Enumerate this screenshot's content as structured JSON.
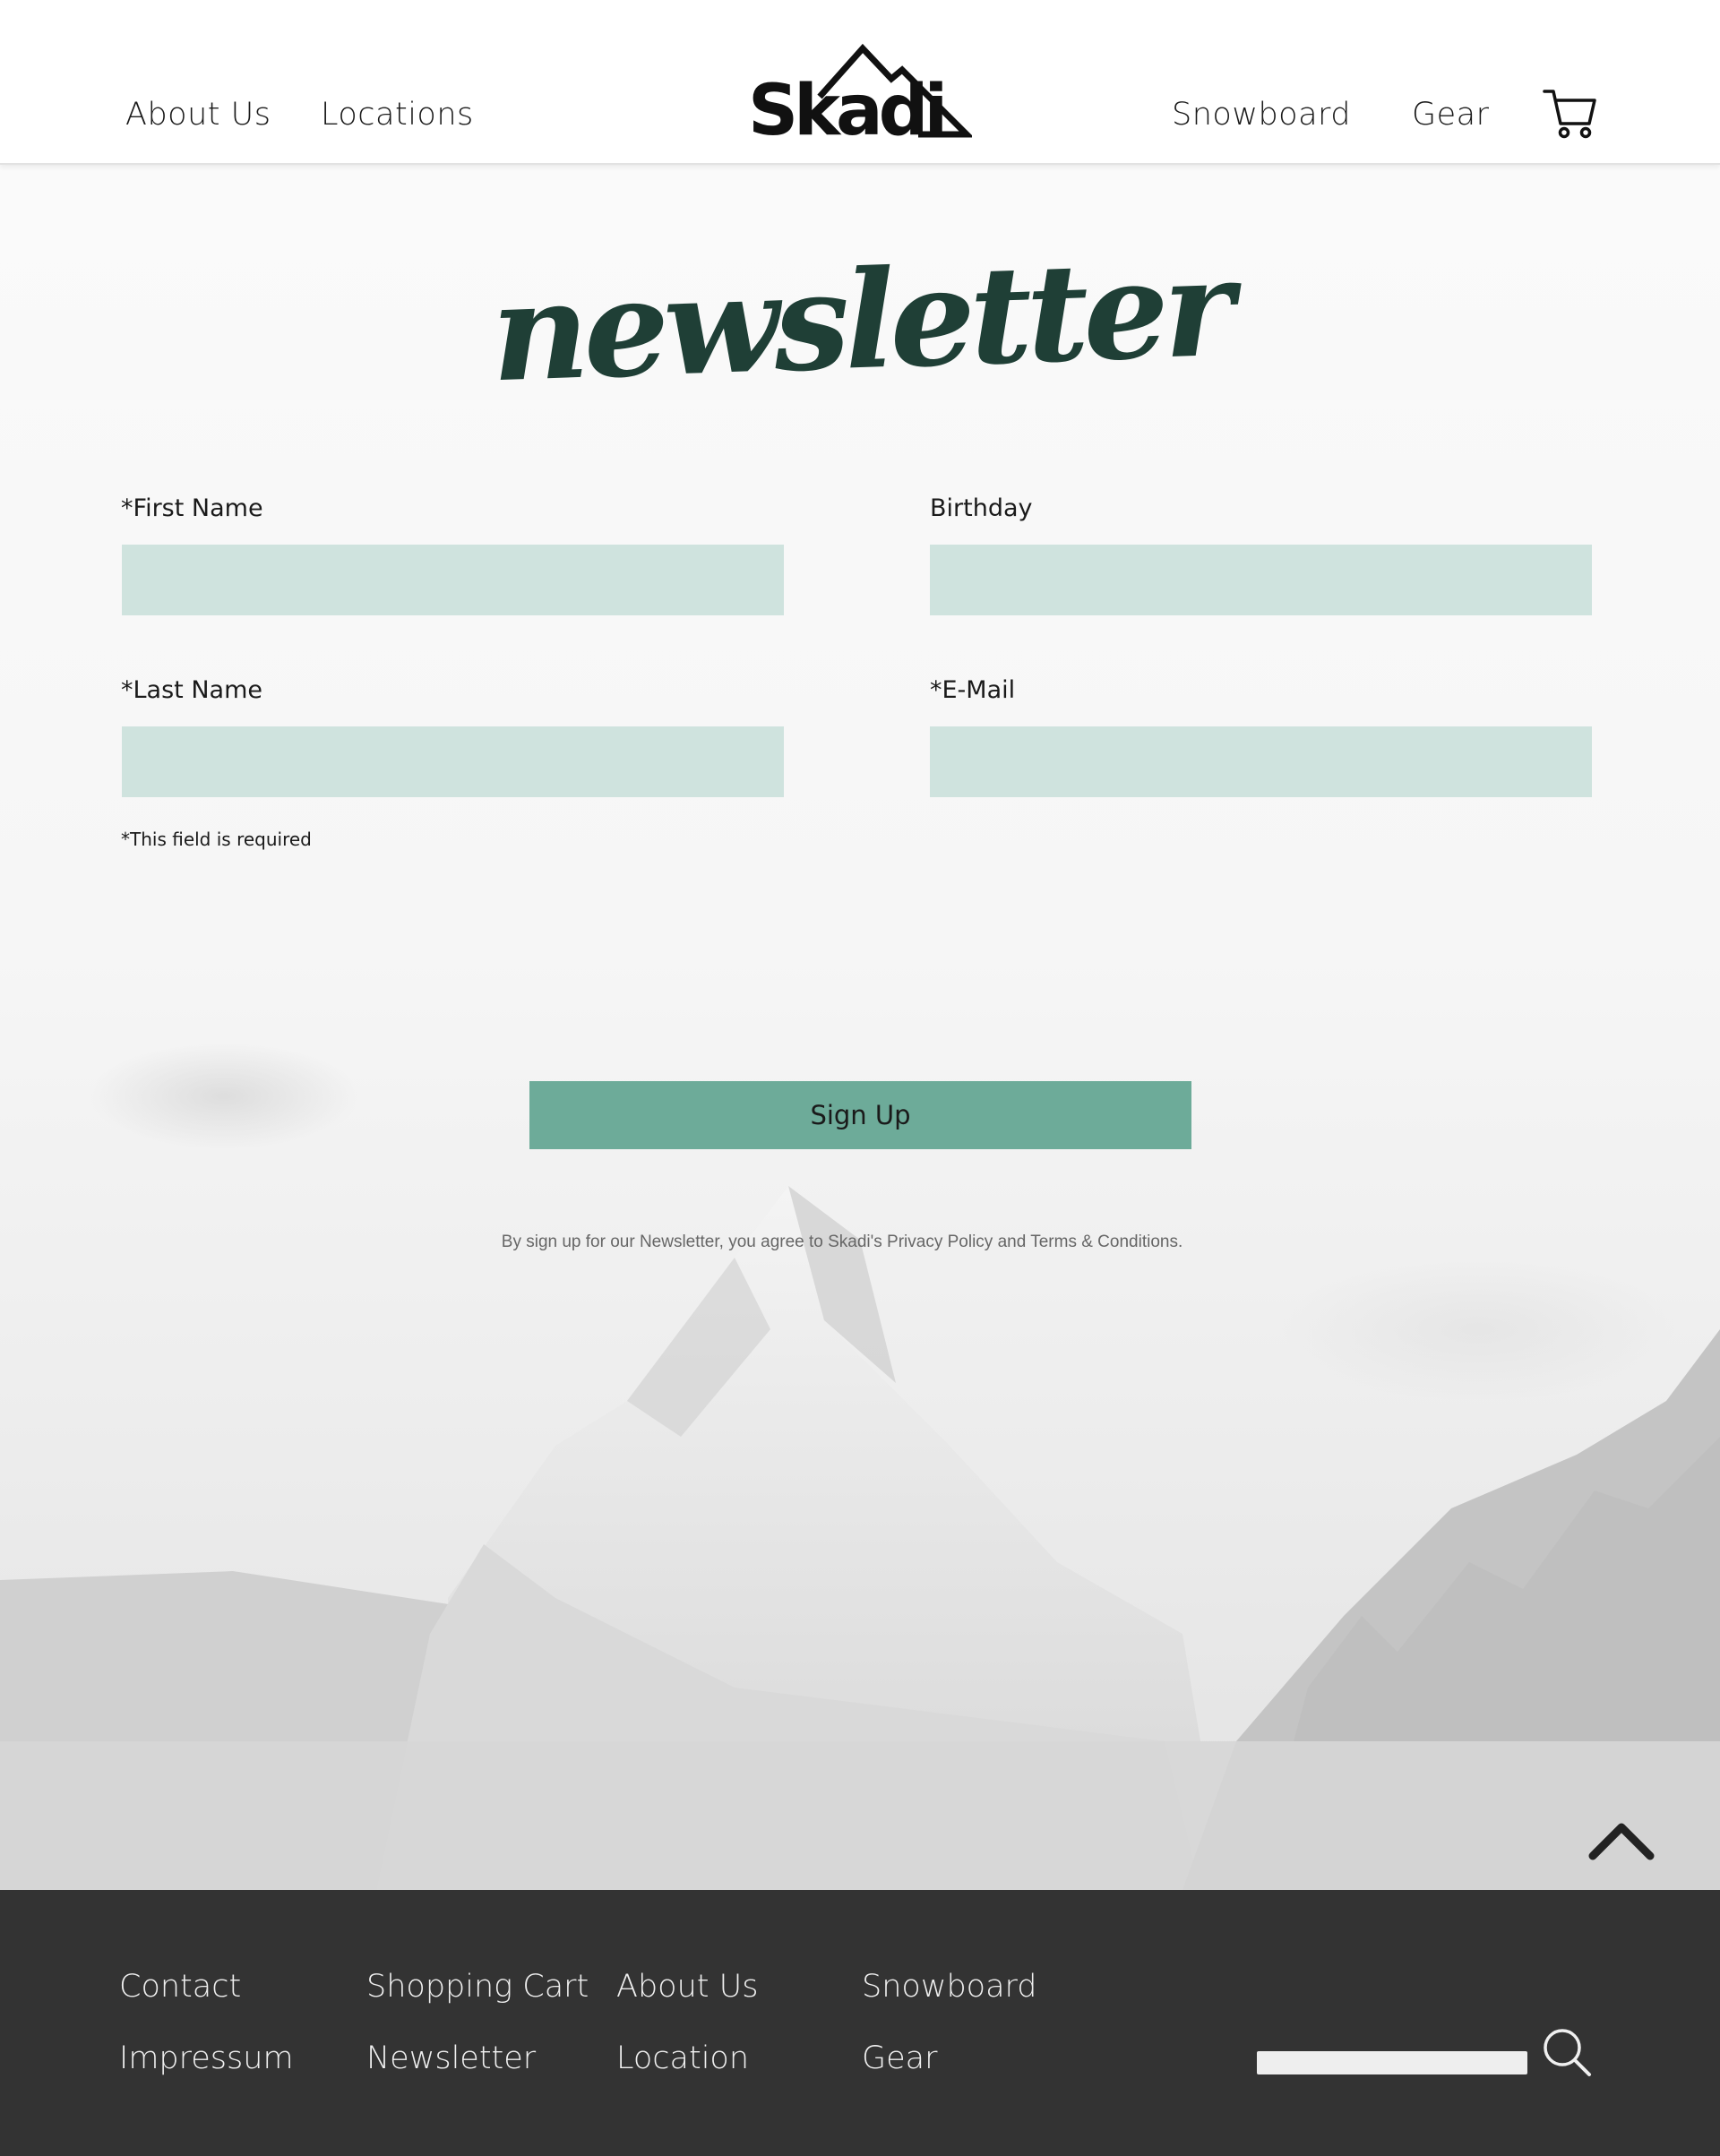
{
  "header": {
    "nav_left": [
      "About Us",
      "Locations"
    ],
    "nav_right": [
      "Snowboard",
      "Gear"
    ],
    "logo_text": "Skadi"
  },
  "main": {
    "title": "newsletter",
    "fields": {
      "first_name": {
        "label": "*First Name",
        "value": ""
      },
      "birthday": {
        "label": "Birthday",
        "value": ""
      },
      "last_name": {
        "label": "*Last Name",
        "value": ""
      },
      "email": {
        "label": "*E-Mail",
        "value": ""
      }
    },
    "required_note": "*This field is required",
    "signup_label": "Sign Up",
    "disclaimer": "By sign up for our Newsletter, you agree to Skadi's Privacy Policy and Terms & Conditions."
  },
  "footer": {
    "col1": [
      "Contact",
      "Impressum"
    ],
    "col2": [
      "Shopping Cart",
      "Newsletter"
    ],
    "col3": [
      "About Us",
      "Location"
    ],
    "col4": [
      "Snowboard",
      "Gear"
    ],
    "search_value": ""
  },
  "colors": {
    "accent": "#6dab99",
    "input_bg": "#cfe3de",
    "title": "#1f3f36",
    "footer_bg": "#333333"
  },
  "icons": [
    "skadi-logo-icon",
    "cart-icon",
    "chevron-up-icon",
    "search-icon"
  ]
}
